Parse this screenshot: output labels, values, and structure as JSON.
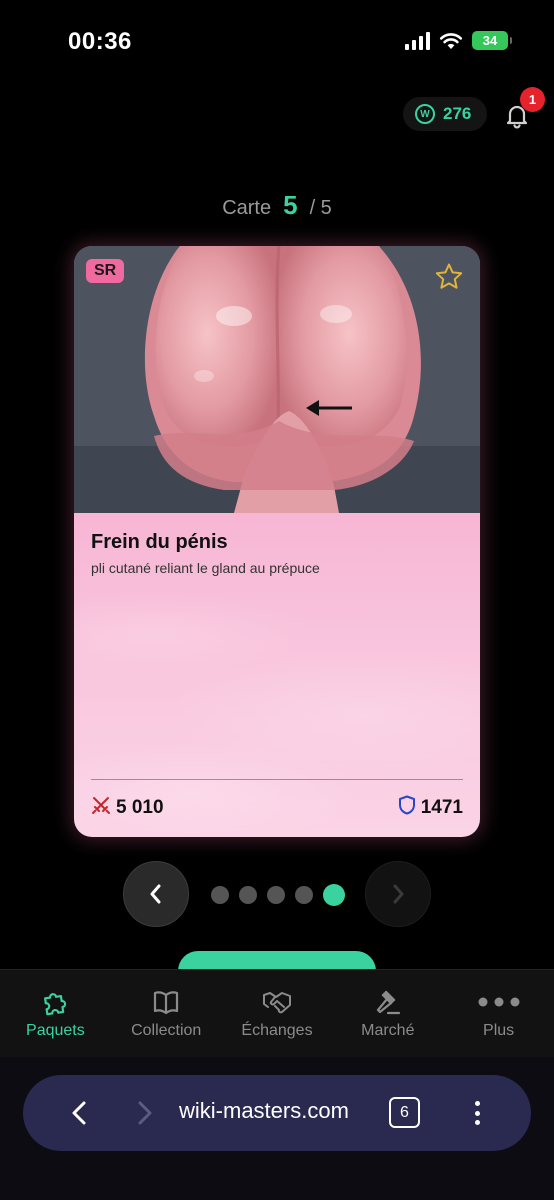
{
  "status_bar": {
    "time": "00:36",
    "battery": "34"
  },
  "header": {
    "coins": "276",
    "coin_symbol": "W",
    "notifications": "1"
  },
  "counter": {
    "label": "Carte",
    "current": "5",
    "total": "/ 5"
  },
  "card": {
    "rarity": "SR",
    "title": "Frein du pénis",
    "description": "pli cutané reliant le gland au prépuce",
    "attack": "5 010",
    "defense": "1471",
    "favorite": false
  },
  "pager": {
    "count": 5,
    "active_index": 4
  },
  "bottom_nav": {
    "items": [
      {
        "label": "Paquets",
        "icon": "puzzle-icon",
        "active": true
      },
      {
        "label": "Collection",
        "icon": "book-icon",
        "active": false
      },
      {
        "label": "Échanges",
        "icon": "handshake-icon",
        "active": false
      },
      {
        "label": "Marché",
        "icon": "gavel-icon",
        "active": false
      },
      {
        "label": "Plus",
        "icon": "more-dots-icon",
        "active": false
      }
    ]
  },
  "browser": {
    "url": "wiki-masters.com",
    "tabs": "6"
  },
  "colors": {
    "accent": "#3ad29f",
    "badge": "#e5232d",
    "rarity": "#f06aa0",
    "card": "#f6b2d2",
    "url_bar": "#2a2950"
  }
}
